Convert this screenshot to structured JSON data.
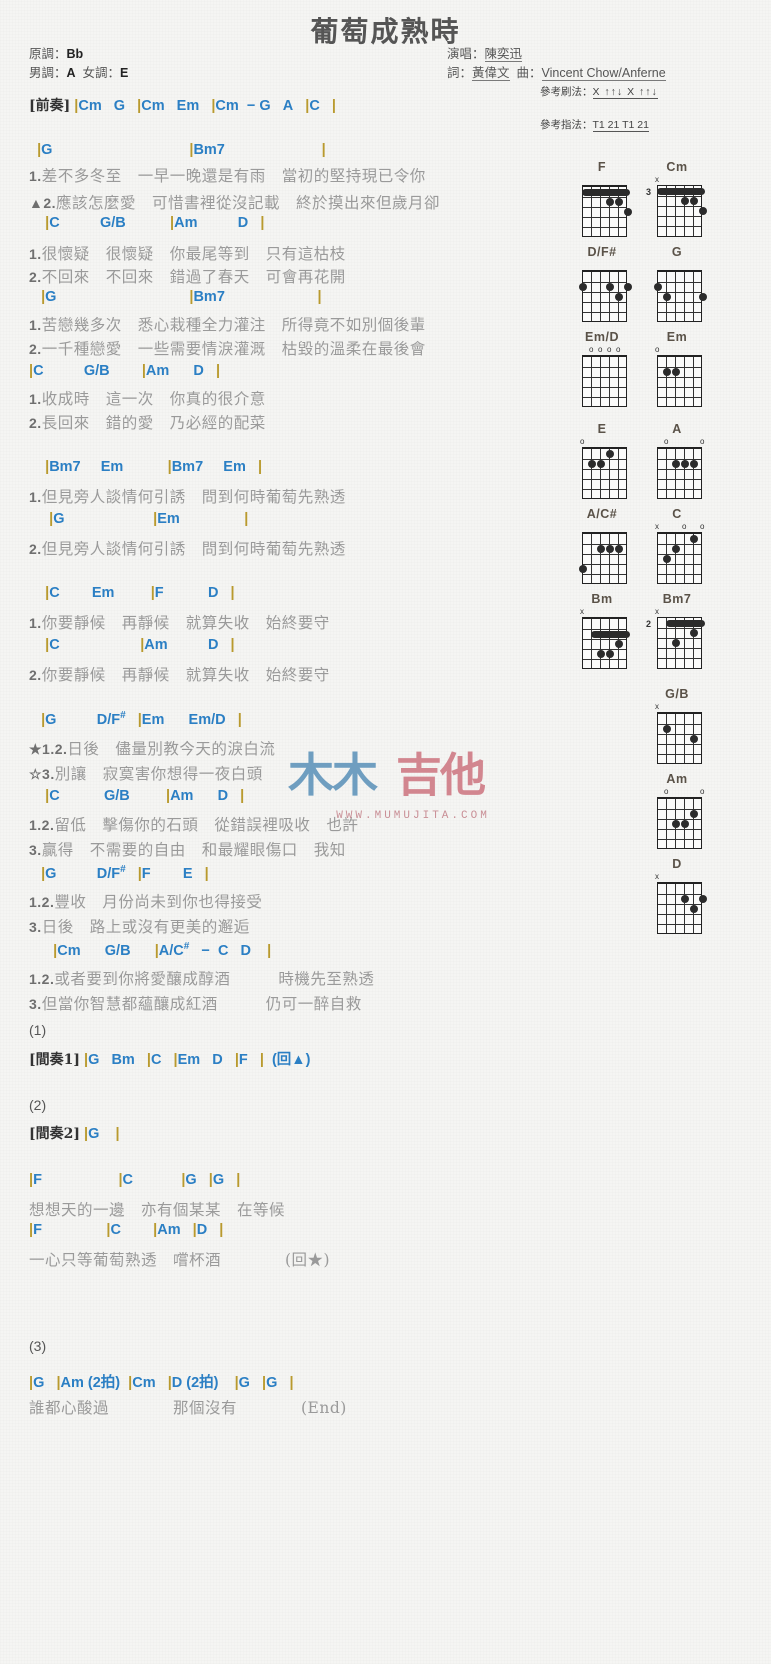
{
  "header": {
    "title": "葡萄成熟時",
    "original_key_label": "原調：",
    "original_key": "Bb",
    "male_key_label": "男調：",
    "male_key": "A",
    "female_key_label": "女調：",
    "female_key": "E",
    "singer_label": "演唱：",
    "singer": "陳奕迅",
    "lyricist_label": "詞：",
    "lyricist": "黃偉文",
    "composer_label": "曲：",
    "composer": "Vincent Chow/Anferne",
    "ref_strum_label": "參考刷法：",
    "ref_strum": "X ↑↑↓ X ↑↑↓",
    "ref_pick_label": "參考指法：",
    "ref_pick": "T1 21 T1 21"
  },
  "watermark": {
    "text": "木木吉他",
    "url": "WWW.MUMUJITA.COM"
  },
  "sections": [
    {
      "type": "chord",
      "tag": "[前奏]",
      "chords": "|Cm   G   |Cm   Em   |Cm  − G   A   |C   |"
    },
    {
      "type": "chord",
      "chords": "  |G                                  |Bm7                        |"
    },
    {
      "type": "lyric",
      "num": "1.",
      "text": "差不多冬至　一早一晚還是有雨　當初的堅持現已令你"
    },
    {
      "type": "lyric",
      "num": "▲2.",
      "text": "應該怎麼愛　可惜書裡從沒記載　終於摸出來但歲月卻"
    },
    {
      "type": "chord",
      "chords": "    |C          G/B           |Am          D   |"
    },
    {
      "type": "lyric",
      "num": "1.",
      "text": "很懷疑　很懷疑　你最尾等到　只有這枯枝"
    },
    {
      "type": "lyric",
      "num": "2.",
      "text": "不回來　不回來　錯過了春天　可會再花開"
    },
    {
      "type": "chord",
      "chords": "   |G                                 |Bm7                       |"
    },
    {
      "type": "lyric",
      "num": "1.",
      "text": "苦戀幾多次　悉心栽種全力灌注　所得竟不如別個後輩"
    },
    {
      "type": "lyric",
      "num": "2.",
      "text": "一千種戀愛　一些需要情淚灌溉　枯毀的溫柔在最後會"
    },
    {
      "type": "chord",
      "chords": "|C          G/B        |Am      D   |"
    },
    {
      "type": "lyric",
      "num": "1.",
      "text": "收成時　這一次　你真的很介意"
    },
    {
      "type": "lyric",
      "num": "2.",
      "text": "長回來　錯的愛　乃必經的配菜"
    },
    {
      "type": "chord",
      "chords": "    |Bm7     Em           |Bm7     Em   |"
    },
    {
      "type": "lyric",
      "num": "1.",
      "text": "但見旁人談情何引誘　問到何時葡萄先熟透"
    },
    {
      "type": "chord",
      "chords": "     |G                      |Em                |"
    },
    {
      "type": "lyric",
      "num": "2.",
      "text": "但見旁人談情何引誘　問到何時葡萄先熟透"
    },
    {
      "type": "chord",
      "chords": "    |C        Em         |F           D   |"
    },
    {
      "type": "lyric",
      "num": "1.",
      "text": "你要靜候　再靜候　就算失收　始終要守"
    },
    {
      "type": "chord",
      "chords": "    |C                    |Am          D   |"
    },
    {
      "type": "lyric",
      "num": "2.",
      "text": "你要靜候　再靜候　就算失收　始終要守"
    },
    {
      "type": "chord",
      "chords": "   |G          D/F#   |Em      Em/D   |"
    },
    {
      "type": "lyric",
      "num": "★1.2.",
      "text": "日後　儘量別教今天的淚白流"
    },
    {
      "type": "lyric",
      "num": "☆3.",
      "text": "別讓　寂寞害你想得一夜白頭"
    },
    {
      "type": "chord",
      "chords": "    |C           G/B         |Am      D   |"
    },
    {
      "type": "lyric",
      "num": "1.2.",
      "text": "留低　擊傷你的石頭　從錯誤裡吸收　也許"
    },
    {
      "type": "lyric",
      "num": "3.",
      "text": "贏得　不需要的自由　和最耀眼傷口　我知"
    },
    {
      "type": "chord",
      "chords": "   |G          D/F#   |F        E   |"
    },
    {
      "type": "lyric",
      "num": "1.2.",
      "text": "豐收　月份尚未到你也得接受"
    },
    {
      "type": "lyric",
      "num": "3.",
      "text": "日後　路上或沒有更美的邂逅"
    },
    {
      "type": "chord",
      "chords": "      |Cm      G/B      |A/C#   −  C   D    |"
    },
    {
      "type": "lyric",
      "num": "1.2.",
      "text": "或者要到你將愛釀成醇酒　　　時機先至熟透"
    },
    {
      "type": "lyric",
      "num": "3.",
      "text": "但當你智慧都蘊釀成紅酒　　　仍可一醉自救"
    },
    {
      "type": "marker",
      "text": "(1)"
    },
    {
      "type": "chord",
      "tag": "[間奏1]",
      "chords": "|G   Bm   |C   |Em   D   |F   |  (回▲)"
    },
    {
      "type": "marker",
      "text": "(2)"
    },
    {
      "type": "chord",
      "tag": "[間奏2]",
      "chords": "|G    |"
    },
    {
      "type": "chord",
      "chords": "|F                   |C            |G   |G   |"
    },
    {
      "type": "lyric",
      "num": "",
      "text": "想想天的一邊　亦有個某某　在等候"
    },
    {
      "type": "chord",
      "chords": "|F                |C        |Am   |D   |"
    },
    {
      "type": "lyric",
      "num": "",
      "text": "一心只等葡萄熟透　嚐杯酒　　　　(回★)"
    },
    {
      "type": "marker",
      "text": "(3)"
    },
    {
      "type": "chord",
      "chords": "|G   |Am (2拍)  |Cm   |D (2拍)    |G   |G   |"
    },
    {
      "type": "lyric",
      "num": "",
      "text": "誰都心酸過　　　　那個沒有　　　　(End)"
    }
  ],
  "chord_diagrams": [
    {
      "name": "F",
      "marks": [
        "",
        "",
        "",
        "",
        "",
        ""
      ],
      "fret": "",
      "barre": {
        "from": 0,
        "to": 5,
        "fret": 1
      },
      "dots": [
        [
          2,
          3
        ],
        [
          2,
          2
        ],
        [
          3,
          1
        ]
      ]
    },
    {
      "name": "Cm",
      "marks": [
        "x",
        "",
        "",
        "",
        "",
        ""
      ],
      "fret": "3",
      "barre": {
        "from": 0,
        "to": 5,
        "fret": 1
      },
      "dots": [
        [
          2,
          3
        ],
        [
          2,
          2
        ],
        [
          3,
          1
        ]
      ]
    },
    {
      "name": "D/F#",
      "marks": [
        "",
        "",
        "",
        "",
        "",
        ""
      ],
      "fret": "",
      "barre": null,
      "dots": [
        [
          2,
          6
        ],
        [
          2,
          3
        ],
        [
          2,
          1
        ],
        [
          3,
          2
        ]
      ]
    },
    {
      "name": "G",
      "marks": [
        "",
        "",
        "",
        "",
        "",
        ""
      ],
      "fret": "",
      "barre": null,
      "dots": [
        [
          2,
          6
        ],
        [
          3,
          5
        ],
        [
          3,
          1
        ]
      ]
    },
    {
      "name": "Em/D",
      "marks": [
        "",
        "o",
        "o",
        "o",
        "o",
        ""
      ],
      "fret": "",
      "barre": null,
      "dots": []
    },
    {
      "name": "Em",
      "marks": [
        "o",
        "",
        "",
        "",
        "",
        ""
      ],
      "fret": "",
      "barre": null,
      "dots": [
        [
          2,
          5
        ],
        [
          2,
          4
        ]
      ]
    },
    {
      "name": "E",
      "marks": [
        "o",
        "",
        "",
        "",
        "",
        ""
      ],
      "fret": "",
      "barre": null,
      "dots": [
        [
          2,
          5
        ],
        [
          2,
          4
        ],
        [
          1,
          3
        ]
      ]
    },
    {
      "name": "A",
      "marks": [
        "",
        "o",
        "",
        "",
        "",
        "o"
      ],
      "fret": "",
      "barre": null,
      "dots": [
        [
          2,
          4
        ],
        [
          2,
          3
        ],
        [
          2,
          2
        ]
      ]
    },
    {
      "name": "A/C#",
      "marks": [
        "",
        "",
        "",
        "",
        "",
        ""
      ],
      "fret": "",
      "barre": null,
      "dots": [
        [
          2,
          4
        ],
        [
          2,
          3
        ],
        [
          2,
          2
        ],
        [
          4,
          6
        ]
      ]
    },
    {
      "name": "C",
      "marks": [
        "x",
        "",
        "",
        "o",
        "",
        "o"
      ],
      "fret": "",
      "barre": null,
      "dots": [
        [
          1,
          2
        ],
        [
          2,
          4
        ],
        [
          3,
          5
        ]
      ]
    },
    {
      "name": "Bm",
      "marks": [
        "x",
        "",
        "",
        "",
        "",
        ""
      ],
      "fret": "",
      "barre": {
        "from": 1,
        "to": 5,
        "fret": 2
      },
      "dots": [
        [
          3,
          2
        ],
        [
          4,
          4
        ],
        [
          4,
          3
        ]
      ]
    },
    {
      "name": "Bm7",
      "marks": [
        "x",
        "",
        "",
        "",
        "",
        ""
      ],
      "fret": "2",
      "barre": {
        "from": 1,
        "to": 5,
        "fret": 1
      },
      "dots": [
        [
          2,
          2
        ],
        [
          3,
          4
        ]
      ]
    },
    {
      "name": "G/B",
      "marks": [
        "x",
        "",
        "",
        "",
        "",
        ""
      ],
      "fret": "",
      "barre": null,
      "dots": [
        [
          2,
          5
        ],
        [
          3,
          2
        ]
      ]
    },
    {
      "name": "Am",
      "marks": [
        "",
        "o",
        "",
        "",
        "",
        "o"
      ],
      "fret": "",
      "barre": null,
      "dots": [
        [
          2,
          2
        ],
        [
          3,
          4
        ],
        [
          3,
          3
        ]
      ]
    },
    {
      "name": "D",
      "marks": [
        "x",
        "",
        "",
        "",
        "",
        ""
      ],
      "fret": "",
      "barre": null,
      "dots": [
        [
          2,
          3
        ],
        [
          2,
          1
        ],
        [
          3,
          2
        ]
      ]
    }
  ]
}
